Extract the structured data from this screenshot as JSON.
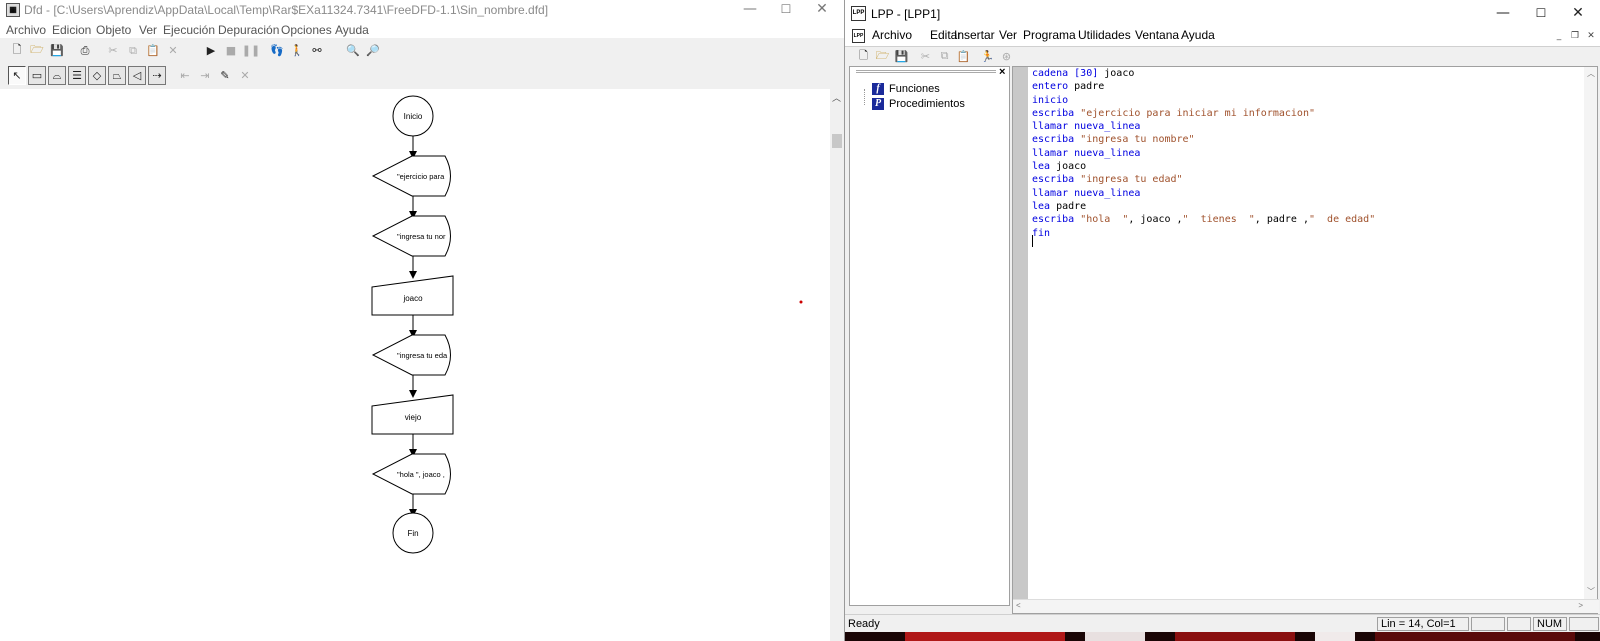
{
  "dfd": {
    "title": "Dfd - [C:\\Users\\Aprendiz\\AppData\\Local\\Temp\\Rar$EXa11324.7341\\FreeDFD-1.1\\Sin_nombre.dfd]",
    "title_icon": "dfd-app-icon",
    "window_controls": {
      "minimize": "—",
      "maximize": "☐",
      "close": "✕"
    },
    "menu": [
      "Archivo",
      "Edicion",
      "Objeto",
      "Ver",
      "Ejecución",
      "Depuración",
      "Opciones",
      "Ayuda"
    ],
    "toolbar1_icons": [
      "new-file-icon",
      "open-folder-icon",
      "save-icon",
      "print-icon",
      "cut-icon",
      "copy-icon",
      "paste-icon",
      "delete-icon",
      "run-icon",
      "stop-icon",
      "pause-icon",
      "step-icon",
      "step-into-icon",
      "watch-icon",
      "zoom-out-icon",
      "zoom-in-icon"
    ],
    "toolbar2_icons": [
      "pointer-icon",
      "assignment-icon",
      "cycle-mientras-icon",
      "cycle-para-icon",
      "decision-icon",
      "read-icon",
      "write-icon",
      "subprogram-icon",
      "insert-object-icon",
      "edit-object-icon",
      "edit-subprogram-icon",
      "delete-subprogram-icon"
    ],
    "flowchart": {
      "nodes": [
        {
          "type": "terminal",
          "text": "Inicio"
        },
        {
          "type": "output",
          "text": "\"ejercicio para"
        },
        {
          "type": "output",
          "text": "\"ingresa tu nor"
        },
        {
          "type": "input",
          "text": "joaco"
        },
        {
          "type": "output",
          "text": "\"ingresa tu eda"
        },
        {
          "type": "input",
          "text": "viejo"
        },
        {
          "type": "output",
          "text": "\"hola \", joaco ,"
        },
        {
          "type": "terminal",
          "text": "Fin"
        }
      ]
    }
  },
  "lpp": {
    "title": "LPP - [LPP1]",
    "title_icon_text": "LPP",
    "window_controls": {
      "minimize": "—",
      "maximize": "☐",
      "close": "✕"
    },
    "menu": [
      "Archivo",
      "Editar",
      "Insertar",
      "Ver",
      "Programa",
      "Utilidades",
      "Ventana",
      "Ayuda"
    ],
    "mdi_controls": {
      "minimize": "_",
      "restore": "❐",
      "close": "✕"
    },
    "toolbar_icons": [
      "new-file-icon",
      "open-folder-icon",
      "save-icon",
      "cut-icon",
      "copy-icon",
      "paste-icon",
      "run-icon",
      "compile-icon"
    ],
    "tree": {
      "items": [
        {
          "icon": "f",
          "label": "Funciones"
        },
        {
          "icon": "P",
          "label": "Procedimientos"
        }
      ]
    },
    "code_lines": [
      [
        {
          "t": "kw",
          "v": "cadena"
        },
        {
          "t": "plain",
          "v": " "
        },
        {
          "t": "kw",
          "v": "[30]"
        },
        {
          "t": "plain",
          "v": " joaco"
        }
      ],
      [
        {
          "t": "kw",
          "v": "entero"
        },
        {
          "t": "plain",
          "v": " padre"
        }
      ],
      [
        {
          "t": "kw",
          "v": "inicio"
        }
      ],
      [
        {
          "t": "kw",
          "v": "escriba"
        },
        {
          "t": "plain",
          "v": " "
        },
        {
          "t": "str",
          "v": "\"ejercicio para iniciar mi informacion\""
        }
      ],
      [
        {
          "t": "kw",
          "v": "llamar"
        },
        {
          "t": "plain",
          "v": " "
        },
        {
          "t": "kw",
          "v": "nueva_linea"
        }
      ],
      [
        {
          "t": "kw",
          "v": "escriba"
        },
        {
          "t": "plain",
          "v": " "
        },
        {
          "t": "str",
          "v": "\"ingresa tu nombre\""
        }
      ],
      [
        {
          "t": "kw",
          "v": "llamar"
        },
        {
          "t": "plain",
          "v": " "
        },
        {
          "t": "kw",
          "v": "nueva_linea"
        }
      ],
      [
        {
          "t": "kw",
          "v": "lea"
        },
        {
          "t": "plain",
          "v": " joaco"
        }
      ],
      [
        {
          "t": "kw",
          "v": "escriba"
        },
        {
          "t": "plain",
          "v": " "
        },
        {
          "t": "str",
          "v": "\"ingresa tu edad\""
        }
      ],
      [
        {
          "t": "kw",
          "v": "llamar"
        },
        {
          "t": "plain",
          "v": " "
        },
        {
          "t": "kw",
          "v": "nueva_linea"
        }
      ],
      [
        {
          "t": "kw",
          "v": "lea"
        },
        {
          "t": "plain",
          "v": " padre"
        }
      ],
      [
        {
          "t": "kw",
          "v": "escriba"
        },
        {
          "t": "plain",
          "v": " "
        },
        {
          "t": "str",
          "v": "\"hola  \""
        },
        {
          "t": "plain",
          "v": ", joaco ,"
        },
        {
          "t": "str",
          "v": "\"  tienes  \""
        },
        {
          "t": "plain",
          "v": ", padre ,"
        },
        {
          "t": "str",
          "v": "\"  de edad\""
        }
      ],
      [
        {
          "t": "kw",
          "v": "fin"
        }
      ],
      []
    ],
    "status": {
      "ready": "Ready",
      "position": "Lin = 14, Col=1",
      "num": "NUM"
    }
  },
  "colors": {
    "keyword": "#0000e0",
    "string": "#a0522d",
    "tree_icon": "#1a2a9a",
    "dfd_menu_text": "#555555",
    "red_dot": "#cc0000"
  }
}
